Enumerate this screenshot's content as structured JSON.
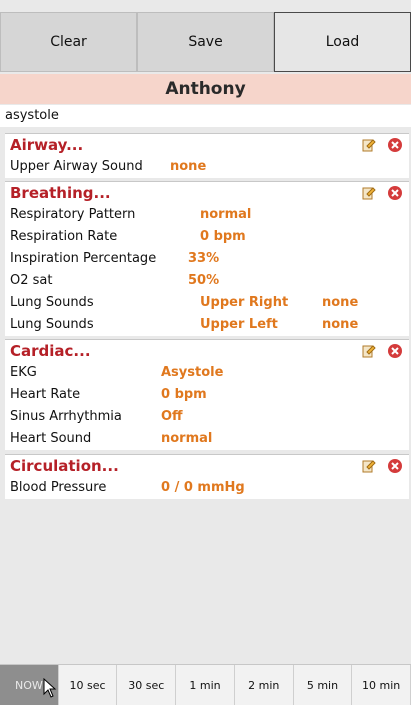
{
  "toolbar": {
    "clear": "Clear",
    "save": "Save",
    "load": "Load"
  },
  "patient": {
    "name": "Anthony"
  },
  "scenario": {
    "value": "asystole"
  },
  "airway": {
    "title": "Airway...",
    "rows": [
      {
        "label": "Upper Airway Sound",
        "value": "none"
      }
    ]
  },
  "breathing": {
    "title": "Breathing...",
    "rows": [
      {
        "label": "Respiratory Pattern",
        "value": "normal"
      },
      {
        "label": "Respiration Rate",
        "value": "0 bpm"
      },
      {
        "label": "Inspiration Percentage",
        "value": "33%"
      },
      {
        "label": "O2 sat",
        "value": "50%"
      },
      {
        "label": "Lung Sounds",
        "value": "Upper Right",
        "value2": "none"
      },
      {
        "label": "Lung Sounds",
        "value": "Upper Left",
        "value2": "none"
      }
    ]
  },
  "cardiac": {
    "title": "Cardiac...",
    "rows": [
      {
        "label": "EKG",
        "value": "Asystole"
      },
      {
        "label": "Heart Rate",
        "value": "0 bpm"
      },
      {
        "label": "Sinus Arrhythmia",
        "value": "Off"
      },
      {
        "label": "Heart Sound",
        "value": "normal"
      }
    ]
  },
  "circulation": {
    "title": "Circulation...",
    "rows": [
      {
        "label": "Blood Pressure",
        "value": "0 / 0 mmHg"
      }
    ]
  },
  "tabs": [
    "NOW",
    "10 sec",
    "30 sec",
    "1 min",
    "2 min",
    "5 min",
    "10 min"
  ],
  "colors": {
    "section_title": "#b52027",
    "value": "#e0781e",
    "patient_bg": "#f6d5cb"
  },
  "icons": {
    "edit": "edit-icon",
    "delete": "delete-icon",
    "cursor": "mouse-pointer-icon"
  }
}
